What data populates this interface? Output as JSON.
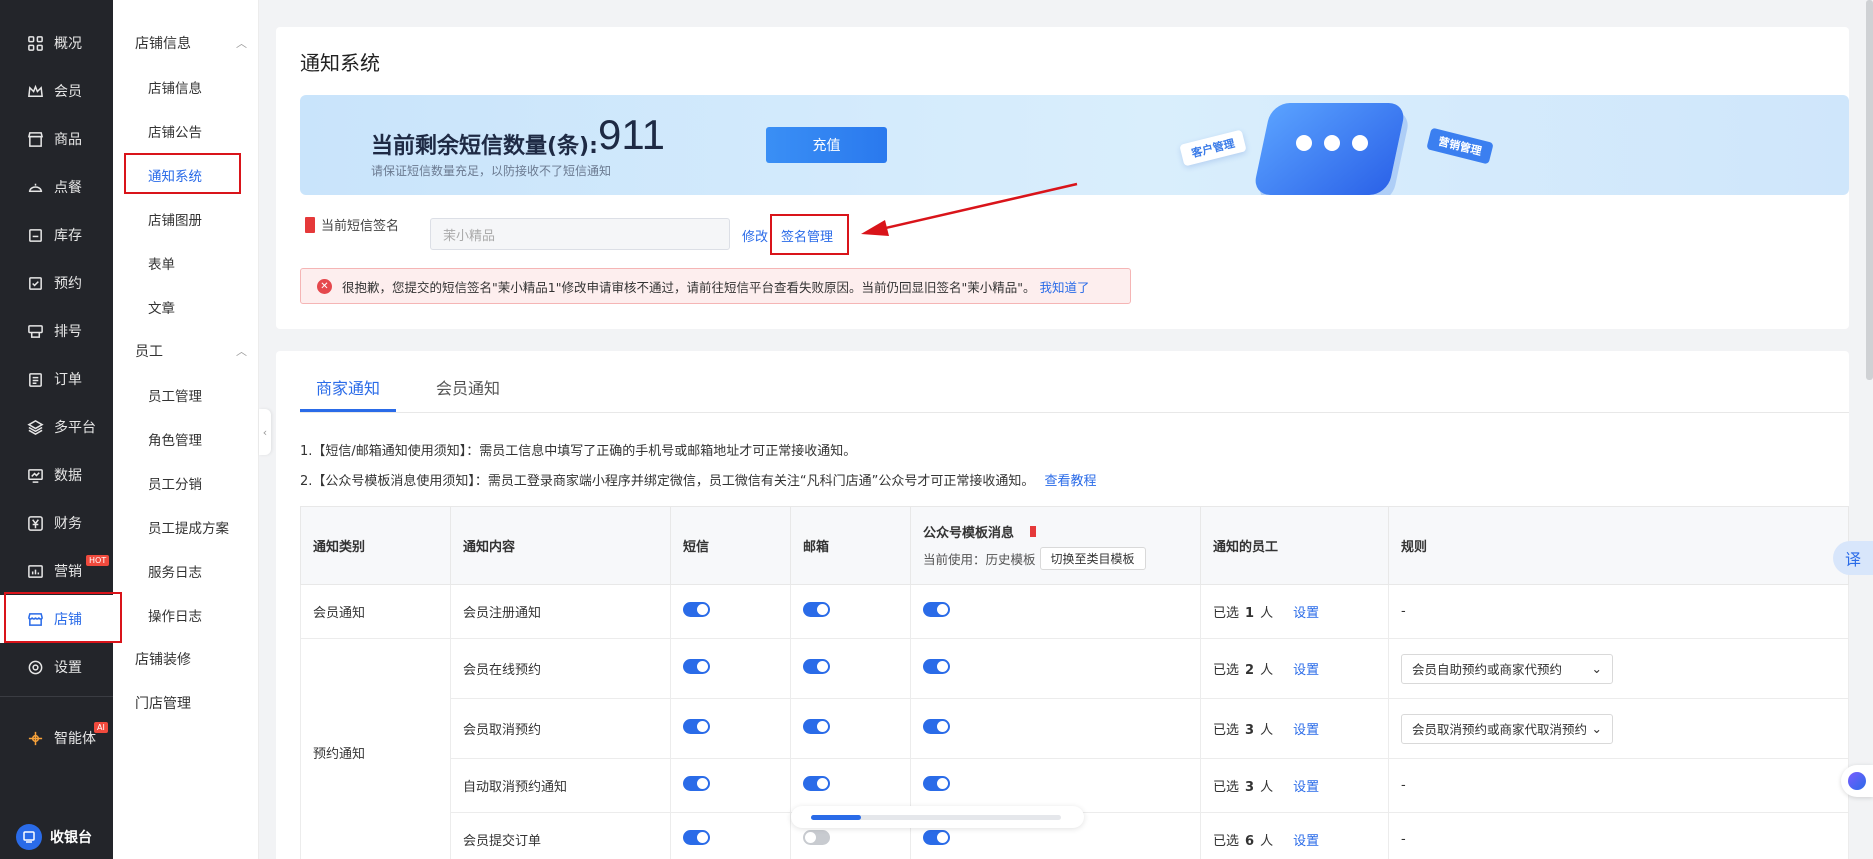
{
  "nav": {
    "items": [
      {
        "label": "概况",
        "icon": "grid-icon"
      },
      {
        "label": "会员",
        "icon": "crown-icon"
      },
      {
        "label": "商品",
        "icon": "shop-icon"
      },
      {
        "label": "点餐",
        "icon": "dish-icon"
      },
      {
        "label": "库存",
        "icon": "box-icon"
      },
      {
        "label": "预约",
        "icon": "calendar-check-icon"
      },
      {
        "label": "排号",
        "icon": "queue-icon"
      },
      {
        "label": "订单",
        "icon": "clipboard-icon"
      },
      {
        "label": "多平台",
        "icon": "layers-icon"
      },
      {
        "label": "数据",
        "icon": "chart-icon"
      },
      {
        "label": "财务",
        "icon": "yuan-icon"
      },
      {
        "label": "营销",
        "icon": "marketing-icon",
        "badge": "HOT"
      },
      {
        "label": "店铺",
        "icon": "store-icon",
        "active": true
      },
      {
        "label": "设置",
        "icon": "gear-icon"
      },
      {
        "label": "智能体",
        "icon": "agent-icon",
        "badge": "AI"
      }
    ],
    "cashier_label": "收银台",
    "accent": "#2a6be8"
  },
  "subnav": {
    "group1": "店铺信息",
    "group1_items": [
      "店铺信息",
      "店铺公告",
      "通知系统",
      "店铺图册",
      "表单",
      "文章"
    ],
    "group2": "员工",
    "group2_items": [
      "员工管理",
      "角色管理",
      "员工分销",
      "员工提成方案",
      "服务日志",
      "操作日志"
    ],
    "plain_items": [
      "店铺装修",
      "门店管理"
    ]
  },
  "page": {
    "title": "通知系统",
    "banner": {
      "label": "当前剩余短信数量(条):",
      "count": "911",
      "sub": "请保证短信数量充足，以防接收不了短信通知",
      "recharge": "充值",
      "tag1": "客户管理",
      "tag2": "营销管理"
    },
    "signature": {
      "label": "当前短信签名",
      "value": "茉小精品",
      "edit": "修改",
      "manage": "签名管理"
    },
    "error": {
      "text": "很抱歉，您提交的短信签名\"茉小精品1\"修改申请审核不通过，请前往短信平台查看失败原因。当前仍回显旧签名\"茉小精品\"。",
      "ack": "我知道了"
    }
  },
  "tabs": [
    "商家通知",
    "会员通知"
  ],
  "notices": {
    "n1": "1.【短信/邮箱通知使用须知】：需员工信息中填写了正确的手机号或邮箱地址才可正常接收通知。",
    "n2": "2.【公众号模板消息使用须知】：需员工登录商家端小程序并绑定微信，员工微信有关注“凡科门店通”公众号才可正常接收通知。",
    "n2_link": "查看教程"
  },
  "table": {
    "headers": {
      "category": "通知类别",
      "content": "通知内容",
      "sms": "短信",
      "email": "邮箱",
      "wechat": "公众号模板消息",
      "wechat_current": "当前使用：历史模板",
      "wechat_switch": "切换至类目模板",
      "staff": "通知的员工",
      "rule": "规则"
    },
    "selected_prefix": "已选",
    "selected_suffix": "人",
    "set_label": "设置",
    "rows": [
      {
        "category": "会员通知",
        "content": "会员注册通知",
        "sms": true,
        "email": true,
        "wechat": true,
        "count": "1",
        "rule": "-"
      },
      {
        "category": "预约通知",
        "content": "会员在线预约",
        "sms": true,
        "email": true,
        "wechat": true,
        "count": "2",
        "rule_select": "会员自助预约或商家代预约"
      },
      {
        "category": "",
        "content": "会员取消预约",
        "sms": true,
        "email": true,
        "wechat": true,
        "count": "3",
        "rule_select": "会员取消预约或商家代取消预约"
      },
      {
        "category": "",
        "content": "自动取消预约通知",
        "sms": true,
        "email": true,
        "wechat": true,
        "count": "3",
        "rule": "-"
      },
      {
        "category": "",
        "content": "会员提交订单",
        "sms": true,
        "email": false,
        "wechat": true,
        "count": "6",
        "rule": "-"
      }
    ]
  },
  "floating": {
    "translate": "译"
  }
}
